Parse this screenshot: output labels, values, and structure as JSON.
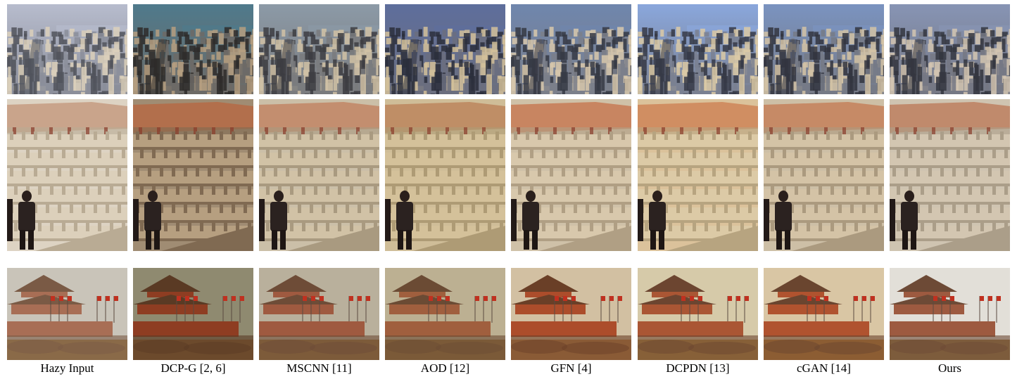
{
  "figure": {
    "rows": [
      "city-skyline",
      "palace-balustrade",
      "tiananmen-gate"
    ],
    "columns": [
      {
        "key": "hazy",
        "label": "Hazy Input",
        "tone": {
          "sky": "#b7bccd",
          "city": "#8b8e9a",
          "shadow": "#51535c",
          "stone": "#dcd0bb",
          "stone_dark": "#b9ab94",
          "roof": "#c9a48b",
          "haze": "#ddd3c3",
          "gate_roof": "#7a5a45",
          "gate_wall": "#a86e55",
          "gate_bg": "#c9c4b9",
          "hedge": "#8a6a48"
        }
      },
      {
        "key": "dcpg",
        "label": "DCP-G [2, 6]",
        "tone": {
          "sky": "#4f7a8c",
          "city": "#6d6a66",
          "shadow": "#2e2b2a",
          "stone": "#b69f80",
          "stone_dark": "#806a52",
          "roof": "#b26f4c",
          "haze": "#a08c73",
          "gate_roof": "#5a3a24",
          "gate_wall": "#8e3d22",
          "gate_bg": "#8f8a70",
          "hedge": "#6c4a2c"
        }
      },
      {
        "key": "mscnn",
        "label": "MSCNN [11]",
        "tone": {
          "sky": "#8c9aa7",
          "city": "#7a7b7e",
          "shadow": "#3d3d42",
          "stone": "#d1c2a6",
          "stone_dark": "#a99a80",
          "roof": "#c38e6f",
          "haze": "#cbbfa8",
          "gate_roof": "#6e4c37",
          "gate_wall": "#9f5a40",
          "gate_bg": "#b9b09c",
          "hedge": "#7d5b3a"
        }
      },
      {
        "key": "aod",
        "label": "AOD [12]",
        "tone": {
          "sky": "#5e6e9c",
          "city": "#6b6f7f",
          "shadow": "#2c2f3c",
          "stone": "#d4c19a",
          "stone_dark": "#ae9b75",
          "roof": "#bf8e66",
          "haze": "#cfbd98",
          "gate_roof": "#6b4b34",
          "gate_wall": "#a05f3e",
          "gate_bg": "#bcb092",
          "hedge": "#7b5a38"
        }
      },
      {
        "key": "gfn",
        "label": "GFN [4]",
        "tone": {
          "sky": "#6f86ad",
          "city": "#7b7f8a",
          "shadow": "#363944",
          "stone": "#d8c8ac",
          "stone_dark": "#b09f84",
          "roof": "#c88561",
          "haze": "#cfc1a8",
          "gate_roof": "#6a3f27",
          "gate_wall": "#ac4d2b",
          "gate_bg": "#d2c0a2",
          "hedge": "#8a5b36"
        }
      },
      {
        "key": "dcpdn",
        "label": "DCPDN [13]",
        "tone": {
          "sky": "#8aa7dc",
          "city": "#7a8091",
          "shadow": "#363a47",
          "stone": "#dccaa6",
          "stone_dark": "#b7a480",
          "roof": "#d08e62",
          "haze": "#dbc29b",
          "gate_roof": "#6c4530",
          "gate_wall": "#aa5634",
          "gate_bg": "#d6caa9",
          "hedge": "#876038"
        }
      },
      {
        "key": "cgan",
        "label": "cGAN [14]",
        "tone": {
          "sky": "#7a93c0",
          "city": "#767a86",
          "shadow": "#33353f",
          "stone": "#d4c3a6",
          "stone_dark": "#ab9a7f",
          "roof": "#c68a66",
          "haze": "#cdbfa6",
          "gate_roof": "#6a452f",
          "gate_wall": "#b0532f",
          "gate_bg": "#d9c6a4",
          "hedge": "#8c5d33"
        }
      },
      {
        "key": "ours",
        "label": "Ours",
        "tone": {
          "sky": "#8794b4",
          "city": "#757884",
          "shadow": "#34363f",
          "stone": "#d3c6b1",
          "stone_dark": "#ab9e89",
          "roof": "#c08a6c",
          "haze": "#cfc4b1",
          "gate_roof": "#6d4a36",
          "gate_wall": "#9d5a40",
          "gate_bg": "#e2dfd8",
          "hedge": "#7d5c3c"
        }
      }
    ]
  }
}
